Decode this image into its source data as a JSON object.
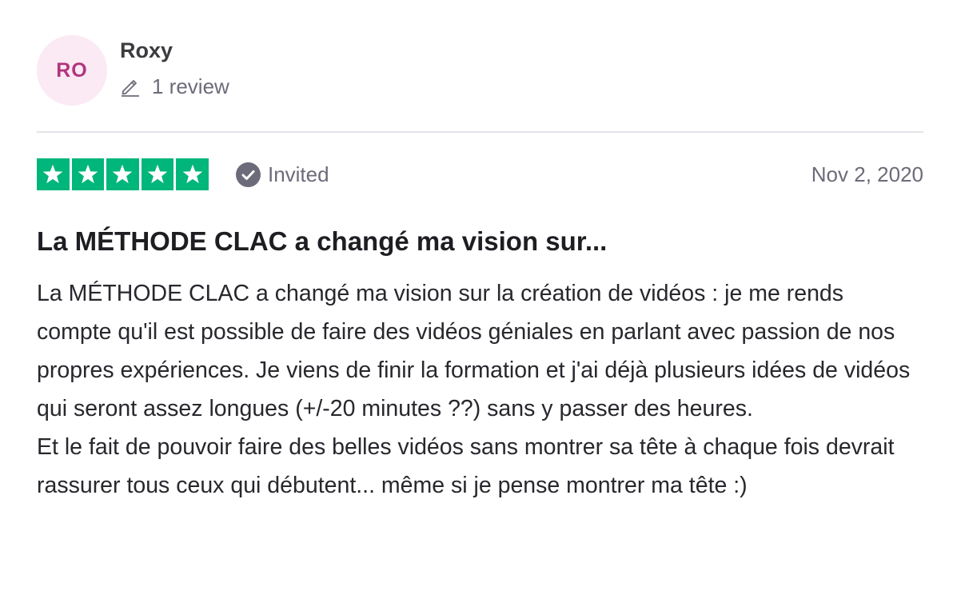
{
  "consumer": {
    "initials": "RO",
    "name": "Roxy",
    "review_count": "1 review",
    "avatar_bg": "#fbe9f4",
    "avatar_text_color": "#b0357d"
  },
  "review": {
    "rating": 5,
    "rating_max": 5,
    "star_color": "#00b67a",
    "status_label": "Invited",
    "date": "Nov 2, 2020",
    "title": "La MÉTHODE CLAC a changé ma vision sur...",
    "body": "La MÉTHODE CLAC a changé ma vision sur la création de vidéos : je me rends compte qu'il est possible de faire des vidéos géniales en parlant avec passion de nos propres expériences. Je viens de finir la formation et j'ai déjà plusieurs idées de vidéos qui seront assez longues (+/-20 minutes ??) sans y passer des heures.\nEt le fait de pouvoir faire des belles vidéos sans montrer sa tête à chaque fois devrait rassurer tous ceux qui débutent... même si je pense montrer ma tête :)"
  },
  "icons": {
    "pencil": "pencil-icon",
    "invited": "verified-check-icon",
    "star": "star-icon"
  }
}
